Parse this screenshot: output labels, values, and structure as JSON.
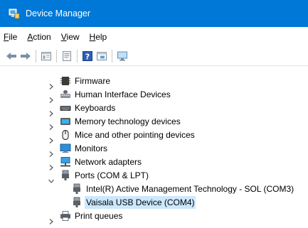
{
  "window": {
    "title": "Device Manager",
    "icon": "device-manager-icon",
    "accent_color": "#0078d7"
  },
  "menu": {
    "items": [
      {
        "key": "F",
        "rest": "ile"
      },
      {
        "key": "A",
        "rest": "ction"
      },
      {
        "key": "V",
        "rest": "iew"
      },
      {
        "key": "H",
        "rest": "elp"
      }
    ]
  },
  "toolbar": {
    "buttons": [
      "back-arrow-icon",
      "forward-arrow-icon",
      "properties-icon",
      "update-driver-icon",
      "help-icon",
      "show-hidden-icon",
      "monitor-scan-icon"
    ]
  },
  "tree": {
    "selected_color": "#cce8ff",
    "items": [
      {
        "label": "Firmware",
        "icon": "firmware-icon",
        "expanded": false
      },
      {
        "label": "Human Interface Devices",
        "icon": "hid-icon",
        "expanded": false
      },
      {
        "label": "Keyboards",
        "icon": "keyboard-icon",
        "expanded": false
      },
      {
        "label": "Memory technology devices",
        "icon": "memory-icon",
        "expanded": false
      },
      {
        "label": "Mice and other pointing devices",
        "icon": "mouse-icon",
        "expanded": false
      },
      {
        "label": "Monitors",
        "icon": "monitor-icon",
        "expanded": false
      },
      {
        "label": "Network adapters",
        "icon": "network-icon",
        "expanded": false
      },
      {
        "label": "Ports (COM & LPT)",
        "icon": "port-icon",
        "expanded": true,
        "children": [
          {
            "label": "Intel(R) Active Management Technology - SOL (COM3)",
            "icon": "port-icon",
            "selected": false
          },
          {
            "label": "Vaisala USB Device (COM4)",
            "icon": "port-icon",
            "selected": true
          }
        ]
      },
      {
        "label": "Print queues",
        "icon": "printer-icon",
        "expanded": false
      }
    ]
  }
}
